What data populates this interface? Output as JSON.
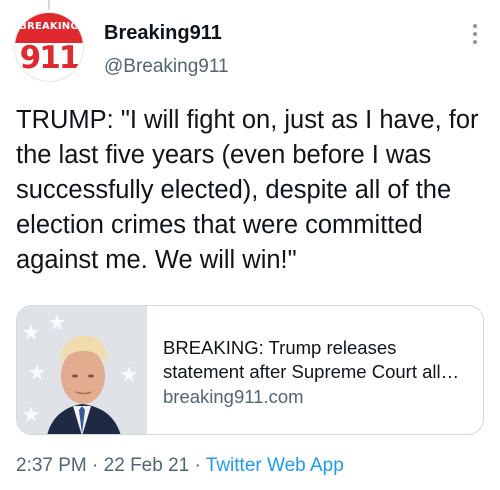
{
  "tweet": {
    "author": {
      "avatar_text_top": "BREAKING",
      "avatar_text_number": "911",
      "display_name": "Breaking911",
      "handle": "@Breaking911"
    },
    "menu_icon": "more-vertical-icon",
    "text": "TRUMP: \"I will fight on, just as I have, for the last five years (even before I was successfully elected), despite all of the election crimes that were committed against me. We will win!\"",
    "card": {
      "image_icon": "portrait-photo",
      "title": "BREAKING: Trump releases statement after Supreme Court all…",
      "domain": "breaking911.com"
    },
    "meta": {
      "time": "2:37 PM",
      "separator": " · ",
      "date": "22 Feb 21",
      "source": "Twitter Web App"
    }
  },
  "colors": {
    "brand_red": "#e0282f",
    "secondary_text": "#536471",
    "link_blue": "#1d9bf0",
    "border": "#cfd9de"
  }
}
